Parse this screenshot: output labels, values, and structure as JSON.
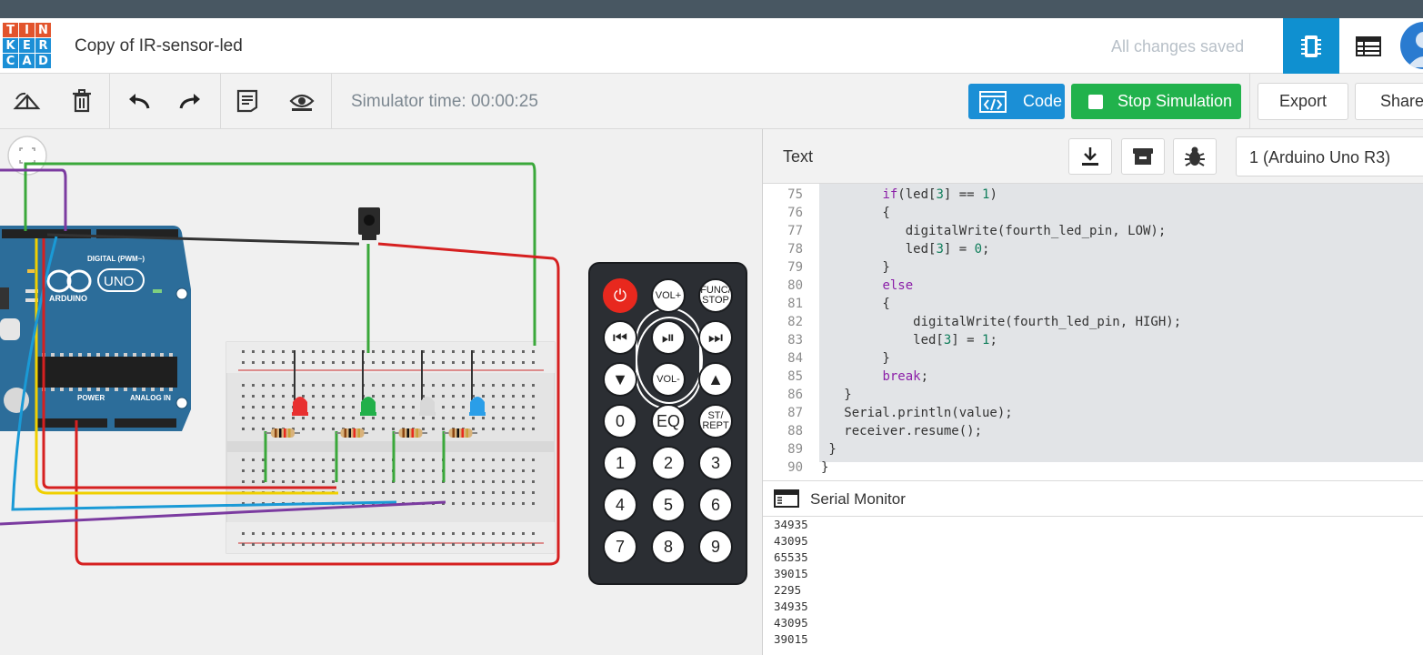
{
  "app": {
    "logo_letters": [
      "T",
      "I",
      "N",
      "K",
      "E",
      "R",
      "C",
      "A",
      "D"
    ],
    "logo_colors": [
      "#e2542c",
      "#e2542c",
      "#e2542c",
      "#1b8fd6",
      "#1b8fd6",
      "#1b8fd6",
      "#1b8fd6",
      "#1b8fd6",
      "#1b8fd6"
    ],
    "title": "Copy of IR-sensor-led",
    "save_status": "All changes saved"
  },
  "toolbar": {
    "simulator_time": "Simulator time: 00:00:25",
    "code_label": "Code",
    "stop_label": "Stop Simulation",
    "export_label": "Export",
    "share_label": "Share"
  },
  "code_panel": {
    "mode_label": "Text",
    "device_select": "1 (Arduino Uno R3)",
    "lines": [
      {
        "n": "75",
        "html": "        <span class='kw'>if</span>(led[<span class='num'>3</span>] == <span class='num'>1</span>)"
      },
      {
        "n": "76",
        "html": "        {"
      },
      {
        "n": "77",
        "html": "           digitalWrite(fourth_led_pin, LOW);"
      },
      {
        "n": "78",
        "html": "           led[<span class='num'>3</span>] = <span class='num'>0</span>;"
      },
      {
        "n": "79",
        "html": "        }"
      },
      {
        "n": "80",
        "html": "        <span class='kw'>else</span>"
      },
      {
        "n": "81",
        "html": "        {"
      },
      {
        "n": "82",
        "html": "            digitalWrite(fourth_led_pin, HIGH);"
      },
      {
        "n": "83",
        "html": "            led[<span class='num'>3</span>] = <span class='num'>1</span>;"
      },
      {
        "n": "84",
        "html": "        }"
      },
      {
        "n": "85",
        "html": "        <span class='kw'>break</span>;"
      },
      {
        "n": "86",
        "html": "   }"
      },
      {
        "n": "87",
        "html": "   Serial.println(value);"
      },
      {
        "n": "88",
        "html": "   receiver.resume();"
      },
      {
        "n": "89",
        "html": " }"
      },
      {
        "n": "90",
        "html": "}"
      }
    ]
  },
  "serial_monitor": {
    "title": "Serial Monitor",
    "output": [
      "34935",
      "43095",
      "65535",
      "39015",
      "2295",
      "34935",
      "43095",
      "39015"
    ]
  },
  "remote": {
    "buttons": [
      "power",
      "VOL+",
      "FUNC/\nSTOP",
      "prev",
      "play-pause",
      "next",
      "down",
      "VOL-",
      "up",
      "0",
      "EQ",
      "ST/\nREPT",
      "1",
      "2",
      "3",
      "4",
      "5",
      "6",
      "7",
      "8",
      "9"
    ]
  },
  "breadboard_leds": [
    "red",
    "green",
    "white",
    "blue"
  ],
  "arduino": {
    "board_label": "ARDUINO",
    "board_model": "UNO",
    "digital_label": "DIGITAL (PWM~)",
    "power_label": "POWER",
    "analog_label": "ANALOG IN"
  }
}
